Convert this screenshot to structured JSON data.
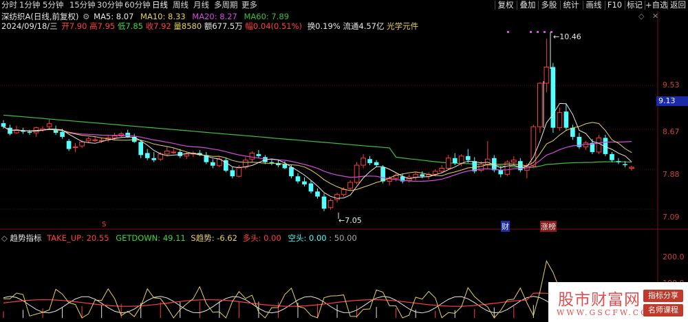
{
  "timeframes": [
    "分时",
    "1分钟",
    "5分钟",
    "15分钟",
    "30分钟",
    "60分钟",
    "日线",
    "周线",
    "月线",
    "多周期",
    "更多"
  ],
  "active_timeframe": "日线",
  "right_buttons": [
    "复权",
    "叠加",
    "多股",
    "统计",
    "画线",
    "F10",
    "标记",
    "+自选",
    "返回"
  ],
  "stock": {
    "name": "深纺织A",
    "period": "(日线,前复权)"
  },
  "ma": {
    "ma5": "MA5: 8.07",
    "ma10": "MA10: 8.33",
    "ma20": "MA20: 8.27",
    "ma60": "MA60: 7.89"
  },
  "quote": {
    "date": "2024/09/18/三",
    "open": "开7.90",
    "high": "高7.95",
    "low": "低7.85",
    "close": "收7.92",
    "vol": "量8580",
    "amount": "额677.5万",
    "change": "幅0.04(0.51%)",
    "turnover": "换0.19%",
    "float": "流通4.57亿",
    "concept": "光学元件"
  },
  "price_axis": [
    "9.53",
    "8.67",
    "7.88",
    "7.09"
  ],
  "current_price_tag": "9.13",
  "high_label": "10.46",
  "low_label": "7.05",
  "markers": {
    "s": "S",
    "cai": "财",
    "zhangting": "涨榜"
  },
  "indicator": {
    "name": "趋势指标",
    "take_up": "TAKE_UP: 20.55",
    "getdown": "GETDOWN: 49.11",
    "trend": "S趋势: -6.62",
    "duotou": "多头: 0.00",
    "kongtou": "空头: 0.00",
    "fifty": ": 50.00"
  },
  "indicator_axis": [
    "200.0",
    "100.0"
  ],
  "watermark": {
    "main": "股市财富网",
    "url": "WWW.GSCFW.COM",
    "tag1": "指标分享",
    "tag2": "名师课程"
  },
  "colors": {
    "up": "#ff3c3c",
    "down": "#54ffff",
    "ma5": "#e8e8e8",
    "ma10": "#e8d35a",
    "ma20": "#d84ce0",
    "ma60": "#3fbf3f"
  },
  "chart_data": {
    "type": "candlestick",
    "candles": [
      [
        8.79,
        8.85,
        8.68,
        8.72
      ],
      [
        8.7,
        8.76,
        8.55,
        8.58
      ],
      [
        8.6,
        8.74,
        8.58,
        8.66
      ],
      [
        8.64,
        8.7,
        8.58,
        8.62
      ],
      [
        8.62,
        8.66,
        8.56,
        8.6
      ],
      [
        8.6,
        8.72,
        8.52,
        8.7
      ],
      [
        8.66,
        8.73,
        8.62,
        8.68
      ],
      [
        8.72,
        8.86,
        8.68,
        8.78
      ],
      [
        8.66,
        8.74,
        8.56,
        8.6
      ],
      [
        8.62,
        8.68,
        8.48,
        8.52
      ],
      [
        8.44,
        8.48,
        8.24,
        8.28
      ],
      [
        8.32,
        8.4,
        8.22,
        8.32
      ],
      [
        8.34,
        8.46,
        8.3,
        8.42
      ],
      [
        8.44,
        8.52,
        8.4,
        8.48
      ],
      [
        8.46,
        8.52,
        8.42,
        8.46
      ],
      [
        8.44,
        8.5,
        8.4,
        8.45
      ],
      [
        8.46,
        8.54,
        8.42,
        8.5
      ],
      [
        8.5,
        8.6,
        8.46,
        8.54
      ],
      [
        8.54,
        8.62,
        8.5,
        8.58
      ],
      [
        8.6,
        8.66,
        8.5,
        8.52
      ],
      [
        8.52,
        8.58,
        8.4,
        8.42
      ],
      [
        8.42,
        8.46,
        8.1,
        8.16
      ],
      [
        8.2,
        8.28,
        8.06,
        8.1
      ],
      [
        8.1,
        8.22,
        8.02,
        8.06
      ],
      [
        8.08,
        8.22,
        8.04,
        8.18
      ],
      [
        8.18,
        8.32,
        8.14,
        8.24
      ],
      [
        8.22,
        8.3,
        8.18,
        8.22
      ],
      [
        8.22,
        8.28,
        8.1,
        8.14
      ],
      [
        8.14,
        8.22,
        8.08,
        8.18
      ],
      [
        8.18,
        8.24,
        8.12,
        8.2
      ],
      [
        8.2,
        8.26,
        8.14,
        8.16
      ],
      [
        8.16,
        8.22,
        7.98,
        8.02
      ],
      [
        8.02,
        8.08,
        7.9,
        7.95
      ],
      [
        7.95,
        8.12,
        7.92,
        8.08
      ],
      [
        8.06,
        8.1,
        7.82,
        7.85
      ],
      [
        7.86,
        7.92,
        7.7,
        7.74
      ],
      [
        7.74,
        7.96,
        7.72,
        7.92
      ],
      [
        7.92,
        8.12,
        7.88,
        8.06
      ],
      [
        8.08,
        8.24,
        8.02,
        8.2
      ],
      [
        8.18,
        8.26,
        8.1,
        8.14
      ],
      [
        8.12,
        8.16,
        7.98,
        8.02
      ],
      [
        8.02,
        8.08,
        7.96,
        8.0
      ],
      [
        8.0,
        8.06,
        7.92,
        7.96
      ],
      [
        7.98,
        8.04,
        7.88,
        7.9
      ],
      [
        7.92,
        7.96,
        7.7,
        7.74
      ],
      [
        7.74,
        7.8,
        7.6,
        7.64
      ],
      [
        7.64,
        7.72,
        7.54,
        7.58
      ],
      [
        7.6,
        7.66,
        7.4,
        7.44
      ],
      [
        7.44,
        7.5,
        7.3,
        7.34
      ],
      [
        7.34,
        7.4,
        7.05,
        7.1
      ],
      [
        7.12,
        7.3,
        7.08,
        7.26
      ],
      [
        7.28,
        7.42,
        7.22,
        7.38
      ],
      [
        7.38,
        7.52,
        7.34,
        7.48
      ],
      [
        7.5,
        7.66,
        7.46,
        7.62
      ],
      [
        7.62,
        8.02,
        7.58,
        7.96
      ],
      [
        7.96,
        8.18,
        7.9,
        8.1
      ],
      [
        8.08,
        8.14,
        7.96,
        8.0
      ],
      [
        8.02,
        8.06,
        7.92,
        7.96
      ],
      [
        7.92,
        7.96,
        7.6,
        7.64
      ],
      [
        7.64,
        7.74,
        7.56,
        7.7
      ],
      [
        7.7,
        7.8,
        7.64,
        7.76
      ],
      [
        7.74,
        7.8,
        7.6,
        7.64
      ],
      [
        7.66,
        7.78,
        7.62,
        7.72
      ],
      [
        7.72,
        7.82,
        7.66,
        7.78
      ],
      [
        7.78,
        7.84,
        7.7,
        7.74
      ],
      [
        7.74,
        7.82,
        7.68,
        7.78
      ],
      [
        7.78,
        7.88,
        7.74,
        7.84
      ],
      [
        7.84,
        7.96,
        7.8,
        7.9
      ],
      [
        7.9,
        8.16,
        7.86,
        8.1
      ],
      [
        8.1,
        8.2,
        7.96,
        8.0
      ],
      [
        8.0,
        8.18,
        7.94,
        8.14
      ],
      [
        8.14,
        8.28,
        8.0,
        8.06
      ],
      [
        8.04,
        8.12,
        7.8,
        7.84
      ],
      [
        7.86,
        8.04,
        7.82,
        7.98
      ],
      [
        7.98,
        8.44,
        7.9,
        8.08
      ],
      [
        8.1,
        8.16,
        7.82,
        7.86
      ],
      [
        7.86,
        7.94,
        7.72,
        7.78
      ],
      [
        7.78,
        8.06,
        7.74,
        8.02
      ],
      [
        8.02,
        8.14,
        7.96,
        8.06
      ],
      [
        8.04,
        8.1,
        7.82,
        7.86
      ],
      [
        7.86,
        8.0,
        7.7,
        7.94
      ],
      [
        7.94,
        8.76,
        7.9,
        8.72
      ],
      [
        8.72,
        9.6,
        8.6,
        9.58
      ],
      [
        9.58,
        10.46,
        9.4,
        9.9
      ],
      [
        9.9,
        9.98,
        8.6,
        8.7
      ],
      [
        8.7,
        9.1,
        8.64,
        9.0
      ],
      [
        9.02,
        9.18,
        8.66,
        8.7
      ],
      [
        8.7,
        8.76,
        8.46,
        8.52
      ],
      [
        8.52,
        8.6,
        8.28,
        8.32
      ],
      [
        8.32,
        8.44,
        8.26,
        8.4
      ],
      [
        8.4,
        8.48,
        8.18,
        8.22
      ],
      [
        8.22,
        8.56,
        8.18,
        8.5
      ],
      [
        8.5,
        8.56,
        8.14,
        8.18
      ],
      [
        8.18,
        8.22,
        8.02,
        8.06
      ],
      [
        8.04,
        8.1,
        7.98,
        8.02
      ],
      [
        7.98,
        8.04,
        7.92,
        7.96
      ],
      [
        7.9,
        7.95,
        7.85,
        7.92
      ]
    ],
    "ylim": [
      6.9,
      10.6
    ],
    "ticks": [
      9.53,
      8.67,
      7.88,
      7.09
    ]
  }
}
